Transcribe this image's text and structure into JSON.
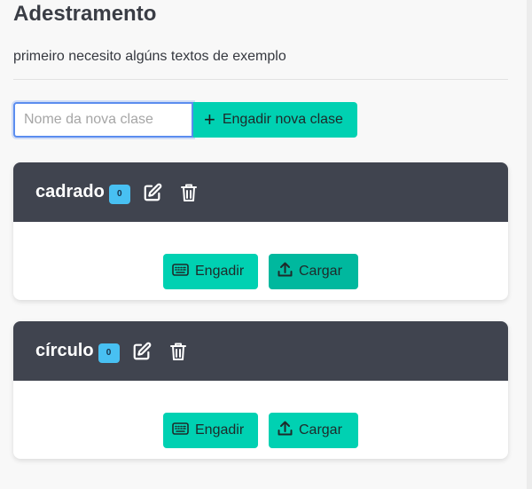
{
  "page": {
    "title": "Adestramento",
    "description": "primeiro necesito algúns textos de exemplo"
  },
  "new_class": {
    "placeholder": "Nome da nova clase",
    "add_label": "Engadir nova clase",
    "plus_icon": "plus-icon"
  },
  "classes": [
    {
      "name": "cadrado",
      "count": "0",
      "add_label": "Engadir",
      "upload_label": "Cargar",
      "upload_active": true
    },
    {
      "name": "círculo",
      "count": "0",
      "add_label": "Engadir",
      "upload_label": "Cargar",
      "upload_active": false
    }
  ],
  "colors": {
    "accent": "#00d1b2",
    "header": "#40444f",
    "badge": "#48c0f2",
    "focus": "#5b8def"
  }
}
